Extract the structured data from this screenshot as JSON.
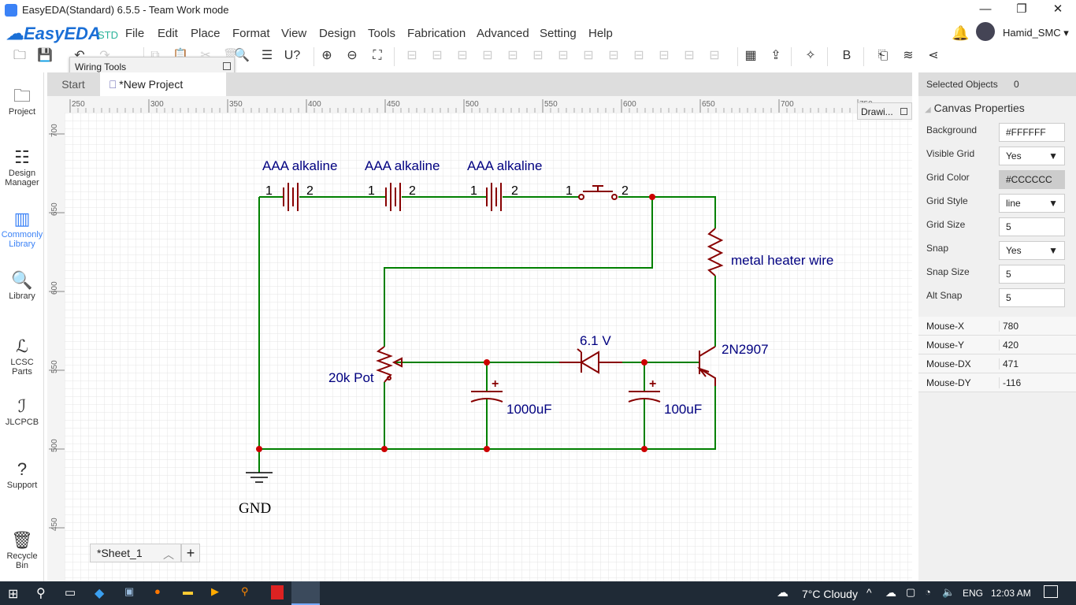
{
  "window": {
    "title": "EasyEDA(Standard) 6.5.5 - Team Work mode",
    "minimize": "—",
    "restore": "❐",
    "close": "✕"
  },
  "brand": {
    "name": "EasyEDA",
    "edition": "STD",
    "accent": "#1a6fd6"
  },
  "menu": [
    "File",
    "Edit",
    "Place",
    "Format",
    "View",
    "Design",
    "Tools",
    "Fabrication",
    "Advanced",
    "Setting",
    "Help"
  ],
  "user": {
    "name": "Hamid_SMC"
  },
  "toolbar_icons": [
    "open-icon",
    "save-icon",
    "undo-icon",
    "redo-icon",
    "copy-icon",
    "paste-icon",
    "cut-icon",
    "delete-icon",
    "search-icon",
    "find-icon",
    "annotate-icon",
    "zoom-in-icon",
    "zoom-out-icon",
    "fit-icon",
    "rotate-left-icon",
    "rotate-right-icon",
    "flip-h-icon",
    "flip-v-icon",
    "align-left-icon",
    "align-right-icon",
    "align-top-icon",
    "align-bottom-icon",
    "align-vcenter-icon",
    "align-hcenter-icon",
    "grid-align-icon",
    "distribute-h-icon",
    "distribute-v-icon",
    "netlist-icon",
    "convert-pcb-icon",
    "design-check-icon",
    "bom-icon",
    "import-icon",
    "layers-icon",
    "share-icon"
  ],
  "wiring_tools": {
    "label": "Wiring Tools"
  },
  "drawing_tools": {
    "label": "Drawi..."
  },
  "sidebar": [
    {
      "label": "Project",
      "icon": "folder-icon"
    },
    {
      "label": "Design Manager",
      "icon": "list-icon"
    },
    {
      "label": "Commonly Library",
      "icon": "chip-icon",
      "active": true
    },
    {
      "label": "Library",
      "icon": "library-search-icon"
    },
    {
      "label": "LCSC Parts",
      "icon": "lcsc-icon"
    },
    {
      "label": "JLCPCB",
      "icon": "jlc-icon"
    },
    {
      "label": "Support",
      "icon": "help-icon"
    },
    {
      "label": "Recycle Bin",
      "icon": "trash-icon"
    }
  ],
  "tabs": [
    {
      "label": "Start"
    },
    {
      "label": "*New Project",
      "active": true
    }
  ],
  "ruler": {
    "x": [
      "250",
      "300",
      "350",
      "400",
      "450",
      "500",
      "550",
      "600",
      "650",
      "700",
      "750"
    ],
    "y": [
      "700",
      "650",
      "600",
      "550",
      "500",
      "450"
    ]
  },
  "schematic": {
    "batteries": [
      {
        "label": "AAA alkaline",
        "pin1": "1",
        "pin2": "2"
      },
      {
        "label": "AAA alkaline",
        "pin1": "1",
        "pin2": "2"
      },
      {
        "label": "AAA alkaline",
        "pin1": "1",
        "pin2": "2"
      }
    ],
    "switch": {
      "pin1": "1",
      "pin2": "2"
    },
    "resistor": "metal heater wire",
    "transistor": "2N2907",
    "zener": "6.1 V",
    "pot": "20k Pot",
    "cap1": "1000uF",
    "cap2": "100uF",
    "cap_plus": "+",
    "gnd": "GND",
    "wire_color": "#008000",
    "part_color": "#880000",
    "label_color": "#000080"
  },
  "sheet": {
    "label": "*Sheet_1",
    "add": "+"
  },
  "properties": {
    "selected_label": "Selected Objects",
    "selected_value": "0",
    "section": "Canvas Properties",
    "rows": [
      {
        "label": "Background",
        "value": "#FFFFFF"
      },
      {
        "label": "Visible Grid",
        "value": "Yes",
        "select": true
      },
      {
        "label": "Grid Color",
        "value": "#CCCCCC"
      },
      {
        "label": "Grid Style",
        "value": "line",
        "select": true
      },
      {
        "label": "Grid Size",
        "value": "5"
      },
      {
        "label": "Snap",
        "value": "Yes",
        "select": true
      },
      {
        "label": "Snap Size",
        "value": "5"
      },
      {
        "label": "Alt Snap",
        "value": "5"
      }
    ],
    "mouse": [
      {
        "label": "Mouse-X",
        "value": "780"
      },
      {
        "label": "Mouse-Y",
        "value": "420"
      },
      {
        "label": "Mouse-DX",
        "value": "471"
      },
      {
        "label": "Mouse-DY",
        "value": "-116"
      }
    ]
  },
  "taskbar": {
    "weather": "7°C  Cloudy",
    "lang": "ENG",
    "time": "12:03 AM"
  }
}
